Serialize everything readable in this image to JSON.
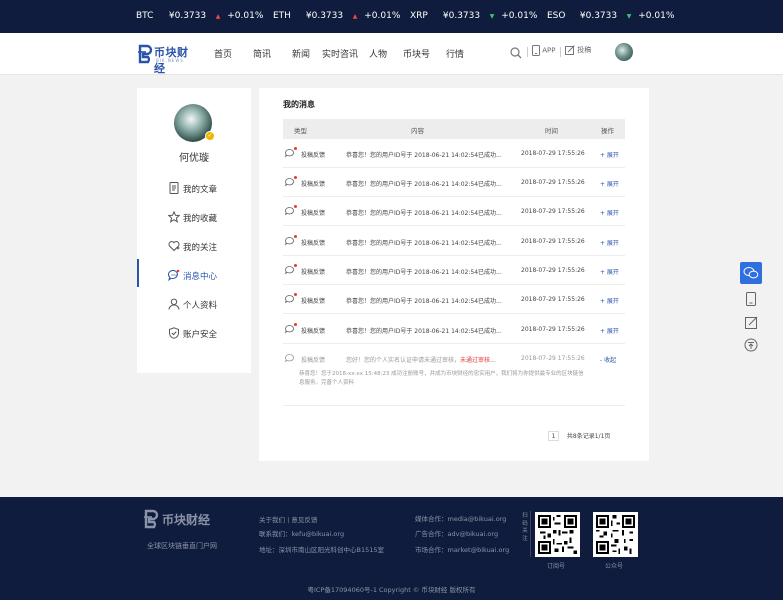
{
  "ticker": [
    {
      "symbol": "BTC",
      "price": "¥0.3733",
      "arrow": "▲",
      "dir": "up",
      "change": "+0.01%"
    },
    {
      "symbol": "ETH",
      "price": "¥0.3733",
      "arrow": "▲",
      "dir": "up",
      "change": "+0.01%"
    },
    {
      "symbol": "XRP",
      "price": "¥0.3733",
      "arrow": "▼",
      "dir": "down",
      "change": "+0.01%"
    },
    {
      "symbol": "ESO",
      "price": "¥0.3733",
      "arrow": "▼",
      "dir": "down",
      "change": "+0.01%"
    }
  ],
  "logo": {
    "text": "币块财经",
    "sub": "BIK.NEWS"
  },
  "nav": [
    "首页",
    "简讯",
    "新闻",
    "实时咨讯",
    "人物",
    "币块号",
    "行情"
  ],
  "header": {
    "app_label": "APP",
    "post_label": "投稿"
  },
  "user": {
    "name": "何优璇",
    "badge": "✓"
  },
  "sidebar": {
    "items": [
      {
        "label": "我的文章",
        "icon": "document-icon"
      },
      {
        "label": "我的收藏",
        "icon": "star-icon"
      },
      {
        "label": "我的关注",
        "icon": "heart-add-icon"
      },
      {
        "label": "消息中心",
        "icon": "message-icon"
      },
      {
        "label": "个人资料",
        "icon": "user-icon"
      },
      {
        "label": "账户安全",
        "icon": "shield-icon"
      }
    ],
    "active_index": 3
  },
  "messages": {
    "title": "我的消息",
    "columns": [
      "类型",
      "内容",
      "时间",
      "操作"
    ],
    "rows": [
      {
        "type": "投稿反馈",
        "content": "恭喜您！您的用户ID号于 2018-06-21 14:02:54已成功...",
        "time": "2018-07-29 17:55:26",
        "op": "+ 展开"
      },
      {
        "type": "投稿反馈",
        "content": "恭喜您！您的用户ID号于 2018-06-21 14:02:54已成功...",
        "time": "2018-07-29 17:55:26",
        "op": "+ 展开"
      },
      {
        "type": "投稿反馈",
        "content": "恭喜您！您的用户ID号于 2018-06-21 14:02:54已成功...",
        "time": "2018-07-29 17:55:26",
        "op": "+ 展开"
      },
      {
        "type": "投稿反馈",
        "content": "恭喜您！您的用户ID号于 2018-06-21 14:02:54已成功...",
        "time": "2018-07-29 17:55:26",
        "op": "+ 展开"
      },
      {
        "type": "投稿反馈",
        "content": "恭喜您！您的用户ID号于 2018-06-21 14:02:54已成功...",
        "time": "2018-07-29 17:55:26",
        "op": "+ 展开"
      },
      {
        "type": "投稿反馈",
        "content": "恭喜您！您的用户ID号于 2018-06-21 14:02:54已成功...",
        "time": "2018-07-29 17:55:26",
        "op": "+ 展开"
      },
      {
        "type": "投稿反馈",
        "content": "恭喜您！您的用户ID号于 2018-06-21 14:02:54已成功...",
        "time": "2018-07-29 17:55:26",
        "op": "+ 展开"
      }
    ],
    "expanded": {
      "type": "投稿反馈",
      "content_prefix": "您好！您的个人实名认证申请未通过审核，",
      "content_red": "未通过审核...",
      "time": "2018-07-29 17:55:26",
      "op": "- 收起",
      "detail": "恭喜您！您于2018-xx-xx 15:48:23 成功注册账号，并成为币块财经的忠实用户，我们将为你提供最专业的区块链信息服务。完善个人资料"
    },
    "pager": {
      "page": "1",
      "summary": "共8条记录1/1页"
    }
  },
  "float_tools": [
    "wechat-icon",
    "phone-icon",
    "edit-icon",
    "back-to-top-icon"
  ],
  "footer": {
    "logo_text": "币块财经",
    "slogan": "全球区块链垂直门户网",
    "links": {
      "about": "关于我们 | 意见反馈",
      "contact": "联系我们：kefu@bikuai.org",
      "address": "地址：深圳市南山区阳光科创中心B1515室",
      "media": "媒体合作：media@bikuai.org",
      "ad": "广告合作：adv@bikuai.org",
      "market": "市场合作：market@bikuai.org"
    },
    "follow_label": "扫码关注",
    "qr_labels": [
      "订阅号",
      "公众号"
    ],
    "copyright": "粤ICP备17094060号-1  Copyright © 币块财经 版权所有"
  },
  "colors": {
    "accent": "#2a54a8",
    "dark_bg": "#101c3d",
    "up": "#f24848",
    "down": "#3bc56c",
    "alert": "#e23b3b"
  }
}
